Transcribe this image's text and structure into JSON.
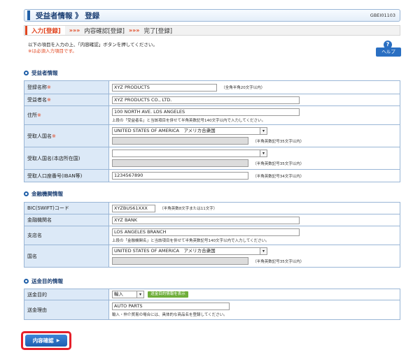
{
  "header": {
    "title": "受益者情報 》 登録",
    "screen_id": "GBEI01103"
  },
  "steps": [
    {
      "label": "入力[登録]"
    },
    {
      "label": "内容確認[登録]"
    },
    {
      "label": "完了[登録]"
    }
  ],
  "step_arrow": "»»»",
  "intro": {
    "line1": "以下の項目を入力の上、「内容確認」ボタンを押してください。",
    "line2": "※は必須入力項目です。"
  },
  "help": {
    "icon": "?",
    "label": "ヘルプ"
  },
  "req_mark": "※",
  "beneficiary": {
    "heading": "受益者情報",
    "registered_name_label": "登録名称",
    "registered_name_value": "XYZ PRODUCTS",
    "registered_name_note": "（全角半角20文字以内）",
    "name_label": "受益者名",
    "name_value": "XYZ PRODUCTS CO., LTD.",
    "address_label": "住所",
    "address_value": "100 NORTH AVE. LOS ANGELES",
    "address_note": "上段の「受益者名」と当該項目を併せて半角英数記号140文字以内で入力してください。",
    "country_label": "受取人国名",
    "country_value": "UNITED STATES OF AMERICA　アメリカ合衆国",
    "country_note": "（半角英数記号35文字以内）",
    "branch_country_label": "受取人国名(本店所在国)",
    "branch_country_value": "",
    "branch_country_note": "（半角英数記号35文字以内）",
    "account_label": "受取人口座番号(IBAN等)",
    "account_value": "1234567890",
    "account_note": "（半角英数記号34文字以内）"
  },
  "bank": {
    "heading": "金融機関情報",
    "bic_label": "BIC(SWIFT)コード",
    "bic_value": "XYZBUS61XXX",
    "bic_note": "（半角英数8文字または11文字）",
    "bank_name_label": "金融機関名",
    "bank_name_value": "XYZ BANK",
    "branch_label": "支店名",
    "branch_value": "LOS ANGELES BRANCH",
    "branch_note": "上段の「金融機関名」と当該項目を併せて半角英数記号140文字以内で入力してください。",
    "country_label": "国名",
    "country_value": "UNITED STATES OF AMERICA　アメリカ合衆国",
    "country_note": "（半角英数記号35文字以内）"
  },
  "purpose": {
    "heading": "送金目的情報",
    "purpose_label": "送金目的",
    "purpose_value": "輸入",
    "purpose_button": "送金目的情報を表示",
    "reason_label": "送金理由",
    "reason_value": "AUTO PARTS",
    "reason_note": "輸入・仲介貿易の場合には、具体的な商品名を登録してください。"
  },
  "submit": {
    "label": "内容確認",
    "arrow": "▶"
  },
  "colors": {
    "accent": "#1f5fa8",
    "required": "#e0451f",
    "highlight": "#e5202a"
  }
}
